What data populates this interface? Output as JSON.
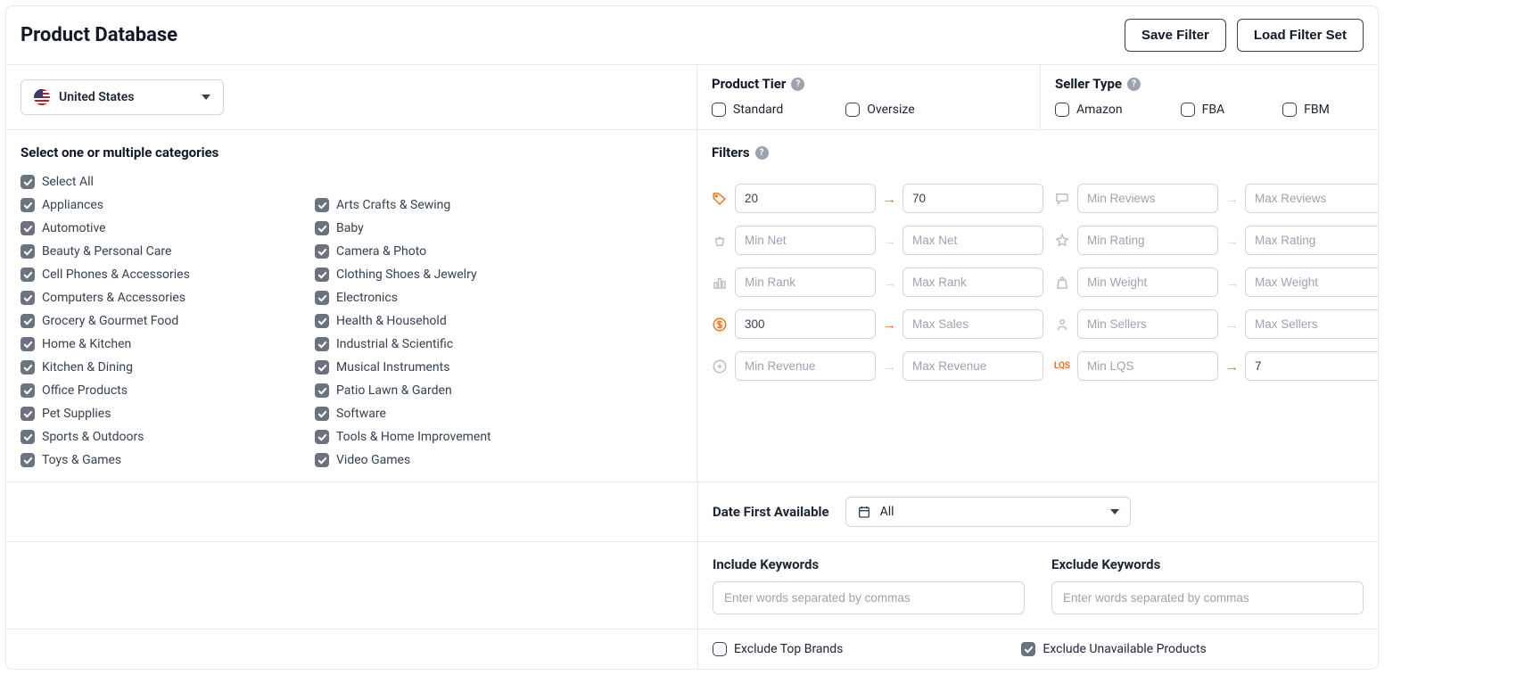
{
  "header": {
    "title": "Product Database",
    "save_filter": "Save Filter",
    "load_filter": "Load Filter Set"
  },
  "marketplace": {
    "label": "United States"
  },
  "product_tier": {
    "title": "Product Tier",
    "standard": "Standard",
    "oversize": "Oversize"
  },
  "seller_type": {
    "title": "Seller Type",
    "amazon": "Amazon",
    "fba": "FBA",
    "fbm": "FBM"
  },
  "categories": {
    "title": "Select one or multiple categories",
    "select_all": "Select All",
    "left": [
      "Appliances",
      "Automotive",
      "Beauty & Personal Care",
      "Cell Phones & Accessories",
      "Computers & Accessories",
      "Grocery & Gourmet Food",
      "Home & Kitchen",
      "Kitchen & Dining",
      "Office Products",
      "Pet Supplies",
      "Sports & Outdoors",
      "Toys & Games"
    ],
    "right": [
      "Arts Crafts & Sewing",
      "Baby",
      "Camera & Photo",
      "Clothing Shoes & Jewelry",
      "Electronics",
      "Health & Household",
      "Industrial & Scientific",
      "Musical Instruments",
      "Patio Lawn & Garden",
      "Software",
      "Tools & Home Improvement",
      "Video Games"
    ]
  },
  "filters": {
    "title": "Filters",
    "price_min": "20",
    "price_max": "70",
    "reviews_min_ph": "Min Reviews",
    "reviews_max_ph": "Max Reviews",
    "net_min_ph": "Min Net",
    "net_max_ph": "Max Net",
    "rating_min_ph": "Min Rating",
    "rating_max_ph": "Max Rating",
    "rank_min_ph": "Min Rank",
    "rank_max_ph": "Max Rank",
    "weight_min_ph": "Min Weight",
    "weight_max_ph": "Max Weight",
    "sales_min": "300",
    "sales_max_ph": "Max Sales",
    "sellers_min_ph": "Min Sellers",
    "sellers_max_ph": "Max Sellers",
    "revenue_min_ph": "Min Revenue",
    "revenue_max_ph": "Max Revenue",
    "lqs_min_ph": "Min LQS",
    "lqs_max": "7"
  },
  "date_first_available": {
    "label": "Date First Available",
    "value": "All"
  },
  "keywords": {
    "include_label": "Include Keywords",
    "exclude_label": "Exclude Keywords",
    "placeholder": "Enter words separated by commas"
  },
  "exclude": {
    "top_brands": "Exclude Top Brands",
    "unavailable": "Exclude Unavailable Products"
  }
}
